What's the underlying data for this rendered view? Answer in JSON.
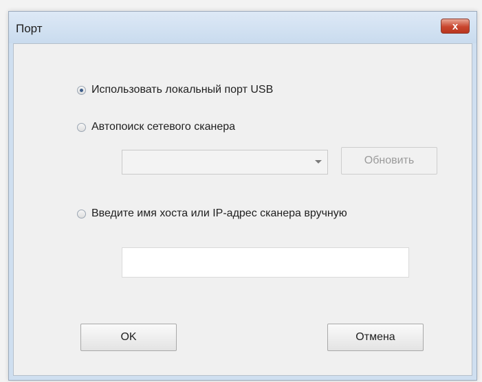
{
  "dialog": {
    "title": "Порт",
    "close_glyph": "x"
  },
  "options": {
    "usb_label": "Использовать локальный порт USB",
    "autosearch_label": "Автопоиск сетевого сканера",
    "manual_label": "Введите имя хоста или IP-адрес сканера вручную",
    "selected": "usb"
  },
  "scanner_select": {
    "selected_value": ""
  },
  "refresh_button": {
    "label": "Обновить",
    "enabled": false
  },
  "host_input": {
    "value": ""
  },
  "footer": {
    "ok_label": "OK",
    "cancel_label": "Отмена"
  },
  "colors": {
    "title_bar": "#c9dbee",
    "close_button": "#c9452e",
    "dialog_bg": "#f0f0f0"
  },
  "icons": {
    "close": "close-icon",
    "dropdown": "chevron-down-icon"
  }
}
